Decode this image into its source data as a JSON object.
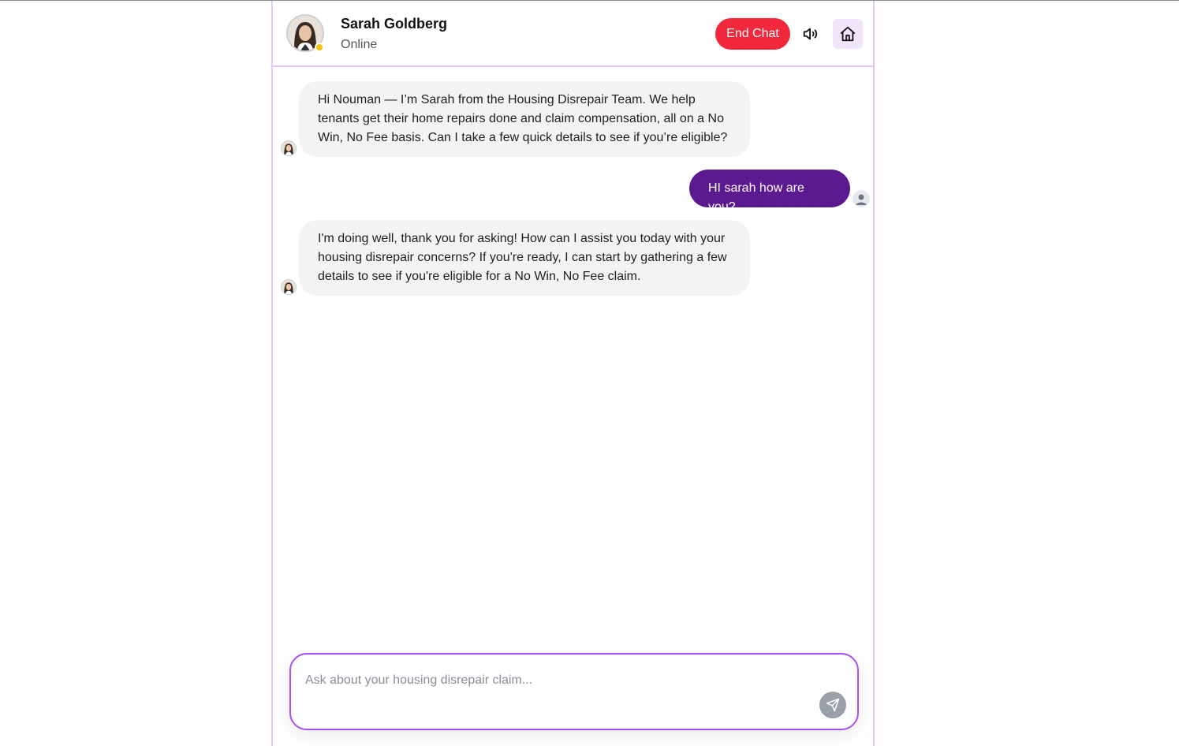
{
  "header": {
    "agent_name": "Sarah Goldberg",
    "agent_status": "Online",
    "status_color": "#f4c20d",
    "end_chat_label": "End Chat",
    "end_chat_color": "#f2283c",
    "speaker_icon": "speaker-icon",
    "home_icon": "home-icon"
  },
  "messages": [
    {
      "sender": "bot",
      "text": "Hi Nouman — I’m Sarah from the Housing Disrepair Team. We help tenants get their home repairs done and claim compensation, all on a No Win, No Fee basis. Can I take a few quick details to see if you’re eligible?"
    },
    {
      "sender": "user",
      "text": "HI sarah how are you?"
    },
    {
      "sender": "bot",
      "text": "I'm doing well, thank you for asking! How can I assist you today with your housing disrepair concerns? If you're ready, I can start by gathering a few details to see if you're eligible for a No Win, No Fee claim."
    }
  ],
  "composer": {
    "placeholder": "Ask about your housing disrepair claim...",
    "value": "",
    "send_icon": "send-icon"
  },
  "colors": {
    "user_bubble": "#5c1a90",
    "bot_bubble": "#f2f3f5",
    "accent_border": "#a94ef0"
  }
}
